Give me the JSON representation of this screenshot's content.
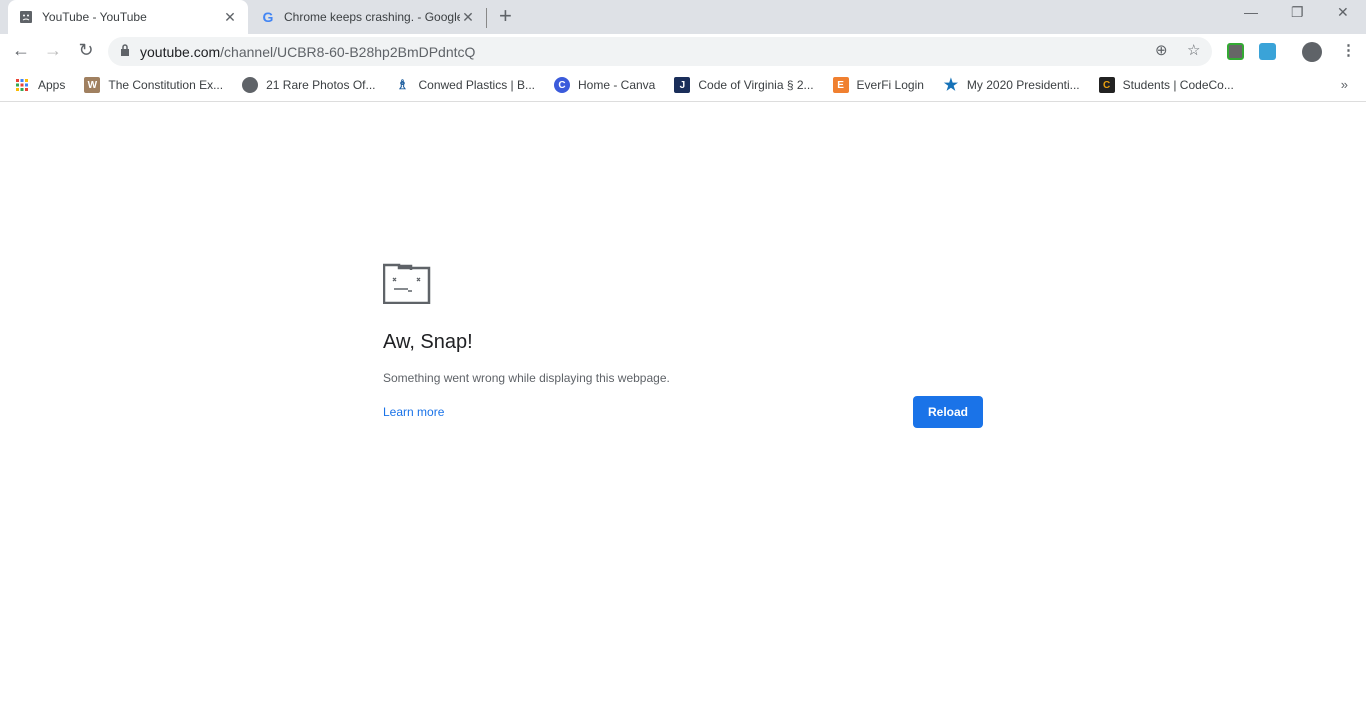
{
  "tabs": [
    {
      "title": "YouTube - YouTube",
      "icon": "sad-page-icon",
      "active": true
    },
    {
      "title": "Chrome keeps crashing. - Google",
      "icon": "google-icon",
      "active": false
    }
  ],
  "address": {
    "domain": "youtube.com",
    "path": "/channel/UCBR8-60-B28hp2BmDPdntcQ"
  },
  "bookmarks": [
    {
      "label": "Apps",
      "icon": "apps-grid-icon"
    },
    {
      "label": "The Constitution Ex...",
      "icon": "constitution-icon",
      "color": "#a08060"
    },
    {
      "label": "21 Rare Photos Of...",
      "icon": "globe-icon",
      "color": "#5f6368"
    },
    {
      "label": "Conwed Plastics | B...",
      "icon": "bbb-icon",
      "color": "#1f5f9f"
    },
    {
      "label": "Home - Canva",
      "icon": "canva-icon",
      "color": "#3b5bdb"
    },
    {
      "label": "Code of Virginia § 2...",
      "icon": "j-icon",
      "color": "#1a2e5a"
    },
    {
      "label": "EverFi Login",
      "icon": "everfi-icon",
      "color": "#f08030"
    },
    {
      "label": "My 2020 Presidenti...",
      "icon": "star-icon",
      "color": "#1672b8"
    },
    {
      "label": "Students | CodeCo...",
      "icon": "codecombat-icon",
      "color": "#e8a010"
    }
  ],
  "error": {
    "title": "Aw, Snap!",
    "message": "Something went wrong while displaying this webpage.",
    "learn_more": "Learn more",
    "reload": "Reload"
  },
  "colors": {
    "accent": "#1a73e8",
    "tabstrip": "#dee1e6"
  }
}
